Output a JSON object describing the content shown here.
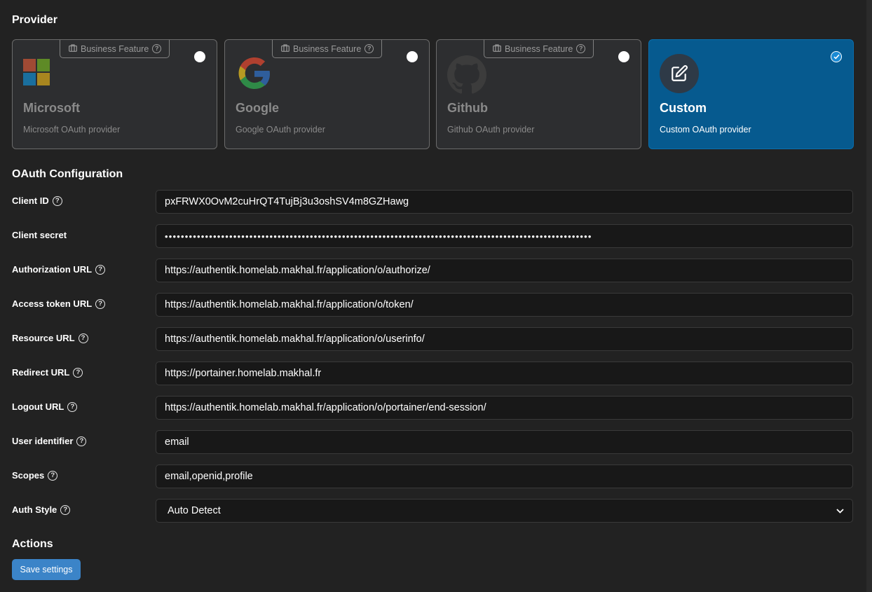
{
  "sections": {
    "provider": "Provider",
    "oauth": "OAuth Configuration",
    "actions": "Actions"
  },
  "providers": [
    {
      "name": "Microsoft",
      "desc": "Microsoft OAuth provider",
      "badge": "Business Feature",
      "selected": false,
      "icon": "microsoft-logo-icon"
    },
    {
      "name": "Google",
      "desc": "Google OAuth provider",
      "badge": "Business Feature",
      "selected": false,
      "icon": "google-logo-icon"
    },
    {
      "name": "Github",
      "desc": "Github OAuth provider",
      "badge": "Business Feature",
      "selected": false,
      "icon": "github-logo-icon"
    },
    {
      "name": "Custom",
      "desc": "Custom OAuth provider",
      "badge": "",
      "selected": true,
      "icon": "edit-icon"
    }
  ],
  "form": {
    "client_id": {
      "label": "Client ID",
      "value": "pxFRWX0OvM2cuHrQT4TujBj3u3oshSV4m8GZHawg"
    },
    "client_secret": {
      "label": "Client secret",
      "value": "••••••••••••••••••••••••••••••••••••••••••••••••••••••••••••••••••••••••••••••••••••••••••••••••••••••••••"
    },
    "authorization_url": {
      "label": "Authorization URL",
      "value": "https://authentik.homelab.makhal.fr/application/o/authorize/"
    },
    "access_token_url": {
      "label": "Access token URL",
      "value": "https://authentik.homelab.makhal.fr/application/o/token/"
    },
    "resource_url": {
      "label": "Resource URL",
      "value": "https://authentik.homelab.makhal.fr/application/o/userinfo/"
    },
    "redirect_url": {
      "label": "Redirect URL",
      "value": "https://portainer.homelab.makhal.fr"
    },
    "logout_url": {
      "label": "Logout URL",
      "value": "https://authentik.homelab.makhal.fr/application/o/portainer/end-session/"
    },
    "user_identifier": {
      "label": "User identifier",
      "value": "email"
    },
    "scopes": {
      "label": "Scopes",
      "value": "email,openid,profile"
    },
    "auth_style": {
      "label": "Auth Style",
      "value": "Auto Detect"
    }
  },
  "help_glyph": "?",
  "save_label": "Save settings",
  "colors": {
    "background": "#222222",
    "card_bg": "#2d2e30",
    "selected_card_bg": "#065a8f",
    "button": "#3b84c8",
    "input_bg": "#181818"
  }
}
